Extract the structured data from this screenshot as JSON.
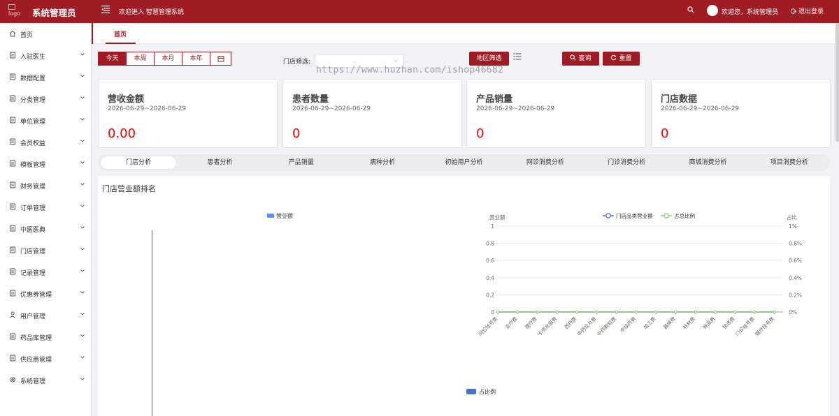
{
  "header": {
    "logo_alt": "logo",
    "brand": "系统管理员",
    "welcome_left": "欢迎进入 智慧管理系统",
    "welcome_right": "欢迎您，系统管理员",
    "logout": "退出登录",
    "color": "#a01c24"
  },
  "sidebar": {
    "items": [
      {
        "label": "首页",
        "icon": "home-icon"
      },
      {
        "label": "入驻医生",
        "icon": "doctor-icon"
      },
      {
        "label": "数据配置",
        "icon": "data-config-icon"
      },
      {
        "label": "分类管理",
        "icon": "category-icon"
      },
      {
        "label": "单位管理",
        "icon": "unit-icon"
      },
      {
        "label": "会员权益",
        "icon": "member-icon"
      },
      {
        "label": "模板管理",
        "icon": "template-icon"
      },
      {
        "label": "财务管理",
        "icon": "finance-icon"
      },
      {
        "label": "订单管理",
        "icon": "order-icon"
      },
      {
        "label": "中医医典",
        "icon": "book-icon"
      },
      {
        "label": "门店管理",
        "icon": "store-icon"
      },
      {
        "label": "记录管理",
        "icon": "record-icon"
      },
      {
        "label": "优惠券管理",
        "icon": "coupon-icon"
      },
      {
        "label": "用户管理",
        "icon": "user-icon"
      },
      {
        "label": "药品库管理",
        "icon": "medicine-icon"
      },
      {
        "label": "供应商管理",
        "icon": "supplier-icon"
      },
      {
        "label": "系统管理",
        "icon": "settings-icon"
      }
    ]
  },
  "tabs": {
    "home": "首页"
  },
  "filters": {
    "periods": [
      "今天",
      "本周",
      "本月",
      "本年"
    ],
    "active_period": "今天",
    "store_label": "门店筛选:",
    "store_value": "",
    "region_button": "地区筛选",
    "query_button": "查询",
    "reset_button": "重置"
  },
  "watermark": "https://www.huzhan.com/ishop46682",
  "cards": [
    {
      "title": "营收金额",
      "date": "2026-06-29~2026-06-29",
      "value": "0.00"
    },
    {
      "title": "患者数量",
      "date": "2026-06-29~2026-06-29",
      "value": "0"
    },
    {
      "title": "产品销量",
      "date": "2026-06-29~2026-06-29",
      "value": "0"
    },
    {
      "title": "门店数据",
      "date": "2026-06-29~2026-06-29",
      "value": "0"
    }
  ],
  "analysis_tabs": [
    "门店分析",
    "患者分析",
    "产品销量",
    "病种分析",
    "初始用户分析",
    "网诊消费分析",
    "门诊消费分析",
    "商城消费分析",
    "项目消费分析"
  ],
  "analysis_active": "门店分析",
  "panel": {
    "title": "门店营业额排名",
    "left_legend": "营业额",
    "bottom_legend": "占比例"
  },
  "chart_data": [
    {
      "type": "bar",
      "title": "门店营业额排名",
      "series": [
        {
          "name": "营业额",
          "values": []
        }
      ],
      "categories": []
    },
    {
      "type": "line",
      "ylabel": "营业额",
      "y2label": "占比",
      "ylim": [
        0,
        1
      ],
      "y2lim": [
        0,
        1
      ],
      "y_ticks": [
        "0",
        "0.2",
        "0.4",
        "0.6",
        "0.8",
        "1"
      ],
      "y2_ticks": [
        "0%",
        "0.2%",
        "0.4%",
        "0.6%",
        "0.8%",
        "1%"
      ],
      "categories": [
        "问诊挂号费",
        "治疗费",
        "理疗费",
        "卡项充值费",
        "西药费",
        "中药饮片费",
        "中药颗粒费",
        "中成药费",
        "加工费",
        "器械费",
        "耗材费",
        "商品费",
        "快递费",
        "门诊挂号费",
        "理疗挂号费"
      ],
      "series": [
        {
          "name": "门店品类营业额",
          "values": [
            0,
            0,
            0,
            0,
            0,
            0,
            0,
            0,
            0,
            0,
            0,
            0,
            0,
            0,
            0
          ],
          "color": "#5b6fd6"
        },
        {
          "name": "占总比例",
          "values": [
            0,
            0,
            0,
            0,
            0,
            0,
            0,
            0,
            0,
            0,
            0,
            0,
            0,
            0,
            0
          ],
          "color": "#91cc75"
        }
      ],
      "legend": "top"
    }
  ]
}
